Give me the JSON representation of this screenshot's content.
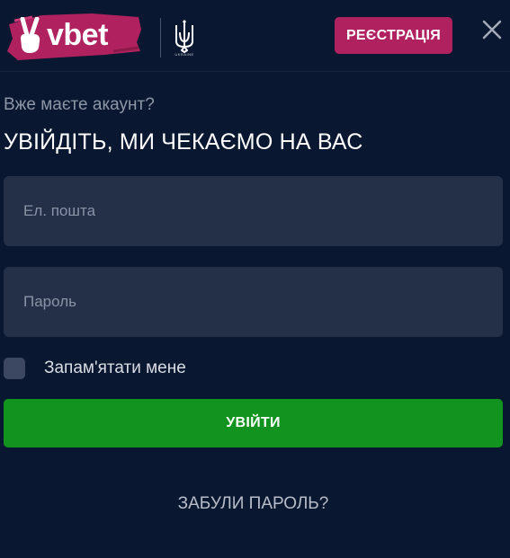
{
  "header": {
    "logo_text": "vbet",
    "logo_caption": "UKRAINE",
    "register_label": "РЕЄСТРАЦІЯ",
    "logo_bg_color": "#b0225f",
    "register_color": "#b0225f",
    "close_icon": "close-icon"
  },
  "login": {
    "subtitle": "Вже маєте акаунт?",
    "title": "УВІЙДІТЬ, МИ ЧЕКАЄМО НА ВАС",
    "email_placeholder": "Ел. пошта",
    "email_value": "",
    "password_placeholder": "Пароль",
    "password_value": "",
    "remember_label": "Запам'ятати мене",
    "remember_checked": false,
    "submit_label": "УВІЙТИ",
    "submit_color": "#12921f",
    "forgot_label": "ЗАБУЛИ ПАРОЛЬ?"
  },
  "theme": {
    "background": "#0a1730",
    "field_background": "#233048"
  }
}
